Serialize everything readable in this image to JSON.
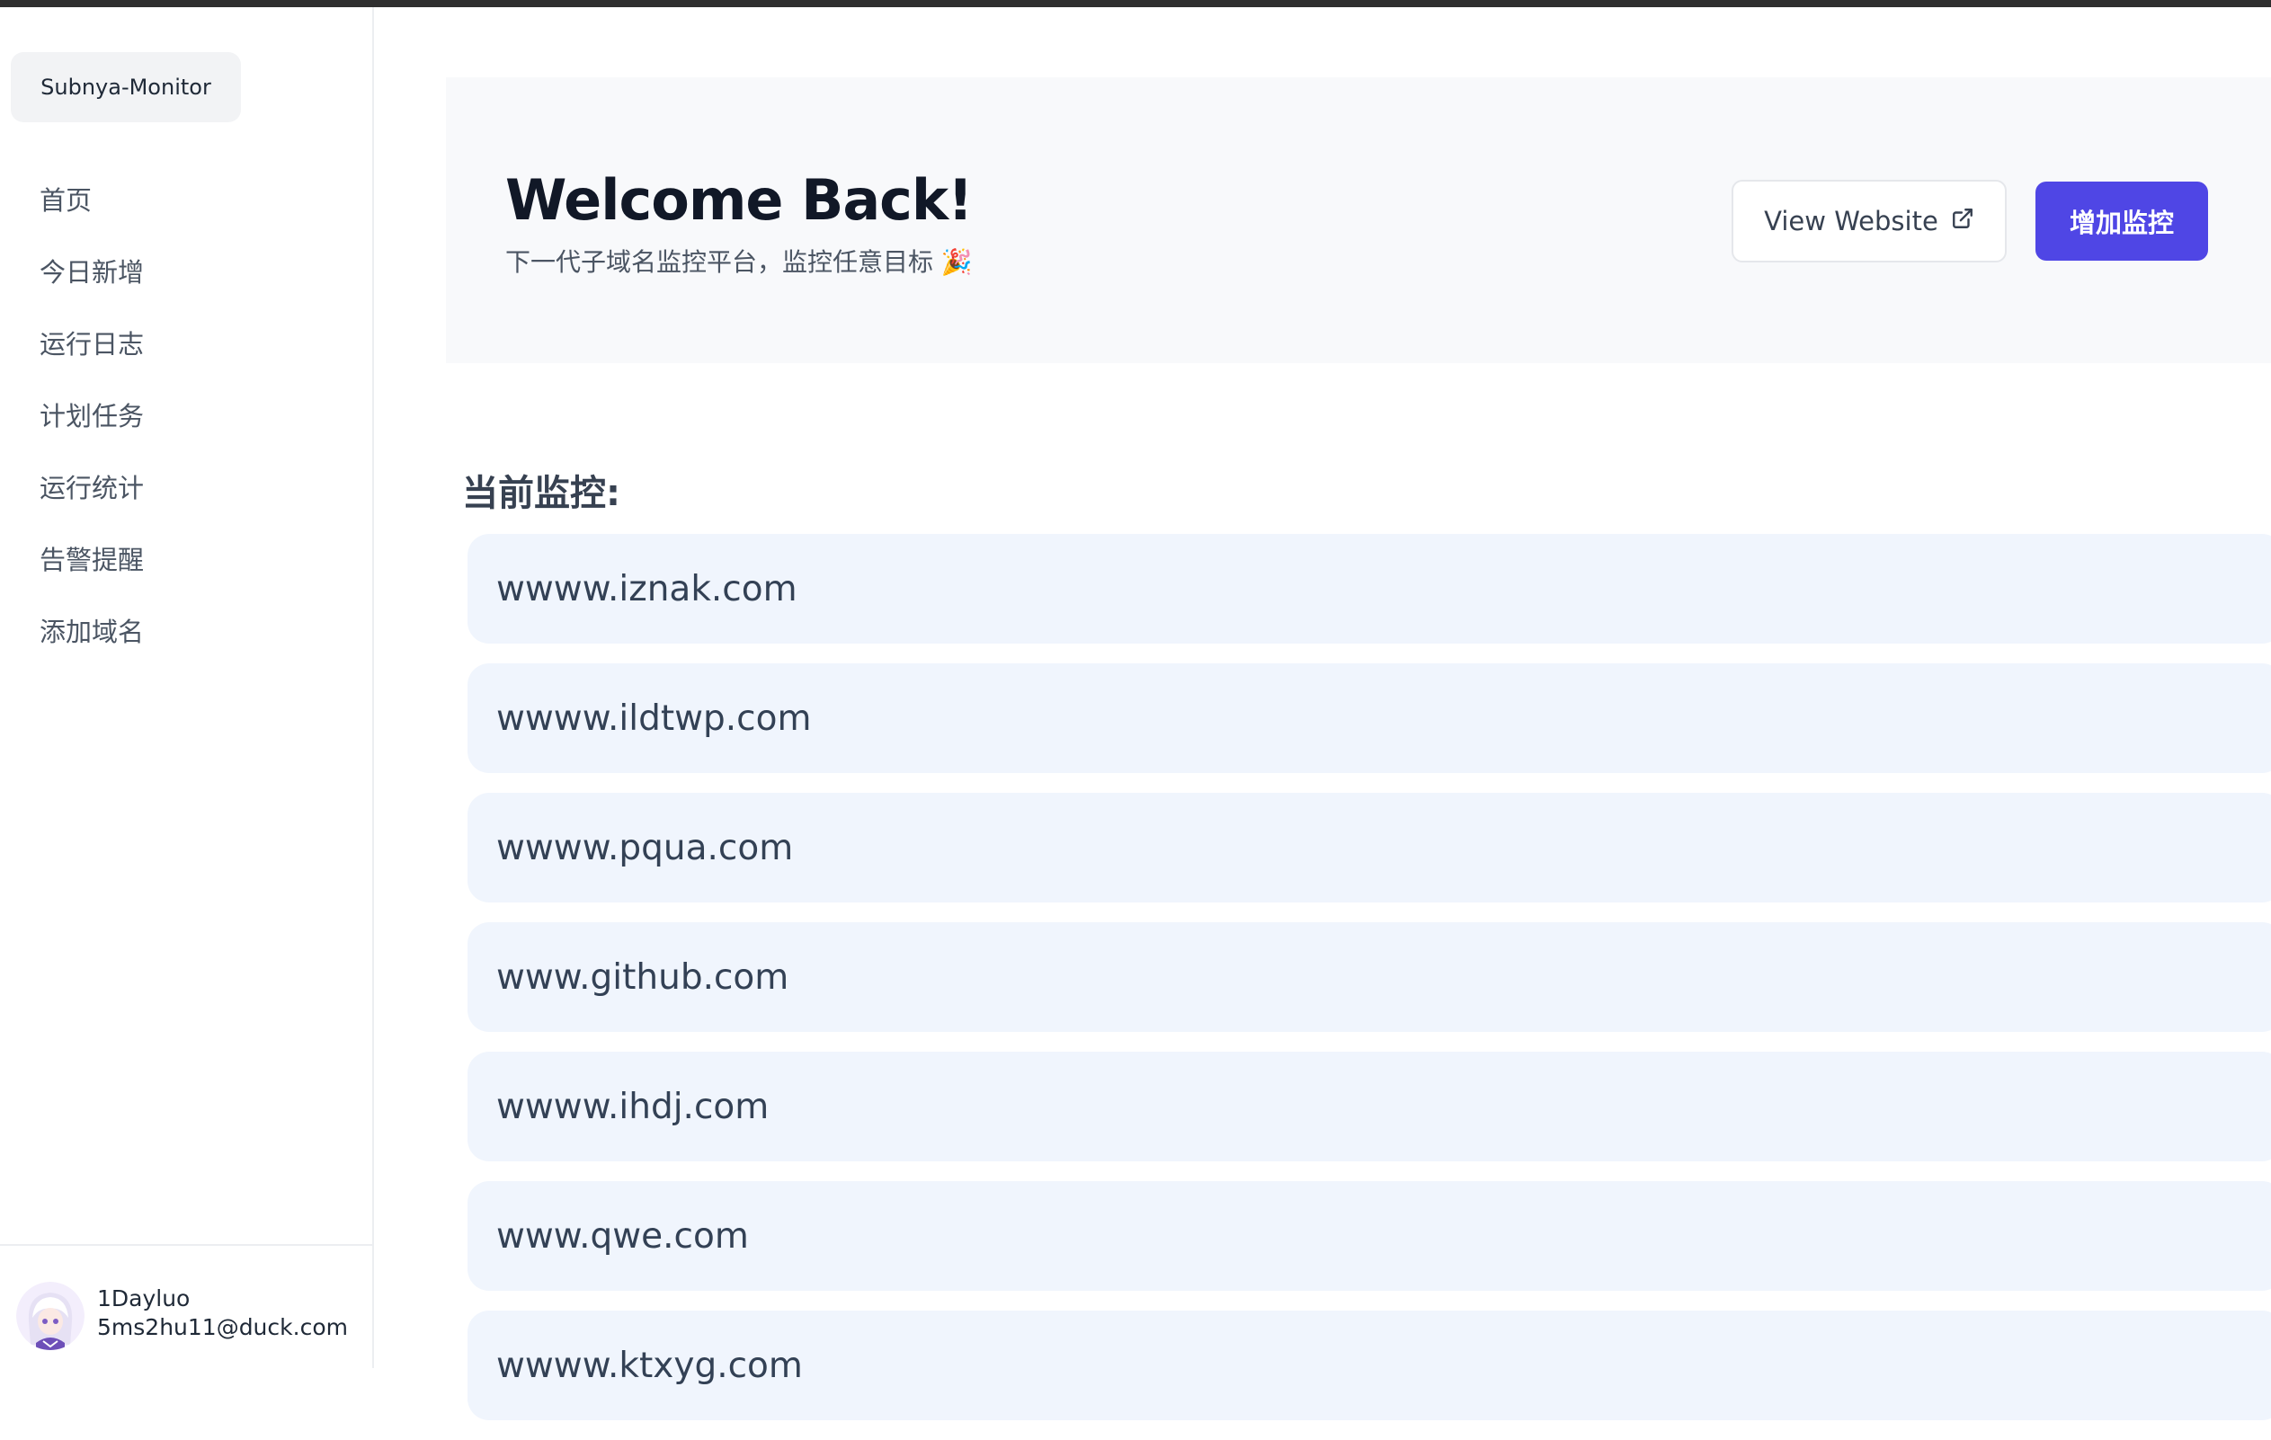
{
  "sidebar": {
    "brand": "Subnya-Monitor",
    "items": [
      {
        "label": "首页"
      },
      {
        "label": "今日新增"
      },
      {
        "label": "运行日志"
      },
      {
        "label": "计划任务"
      },
      {
        "label": "运行统计"
      },
      {
        "label": "告警提醒"
      },
      {
        "label": "添加域名"
      }
    ],
    "user": {
      "name": "1Dayluo",
      "email": "5ms2hu11@duck.com"
    }
  },
  "hero": {
    "title": "Welcome Back!",
    "subtitle": "下一代子域名监控平台，监控任意目标 🎉",
    "view_website_label": "View Website",
    "add_monitor_label": "增加监控"
  },
  "main": {
    "section_title": "当前监控:",
    "domains": [
      "wwww.iznak.com",
      "wwww.ildtwp.com",
      "wwww.pqua.com",
      "www.github.com",
      "wwww.ihdj.com",
      "www.qwe.com",
      "wwww.ktxyg.com"
    ]
  },
  "colors": {
    "accent": "#4f46e5",
    "card_bg": "#f0f5fd",
    "hero_bg": "#f8f9fb"
  },
  "icons": {
    "external_link": "external-link-icon",
    "avatar": "anime-avatar"
  }
}
